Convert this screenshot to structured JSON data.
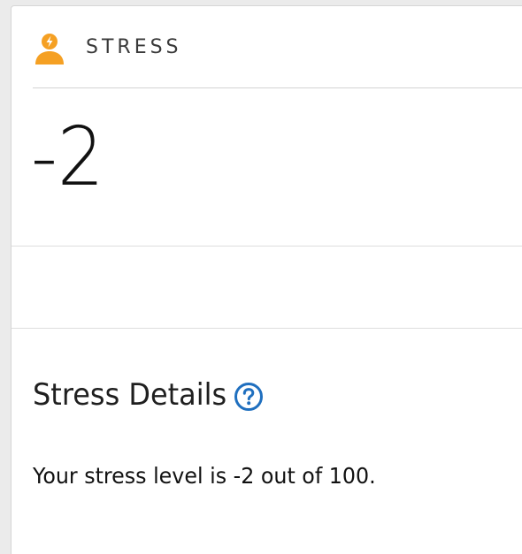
{
  "card": {
    "title": "STRESS",
    "icon": "stressed-person-icon",
    "value": "-2"
  },
  "details": {
    "heading": "Stress Details",
    "help_icon": "help-circle-icon",
    "description": "Your stress level is -2 out of 100."
  },
  "colors": {
    "accent_orange": "#f5a023",
    "help_blue": "#1f6fbf"
  }
}
